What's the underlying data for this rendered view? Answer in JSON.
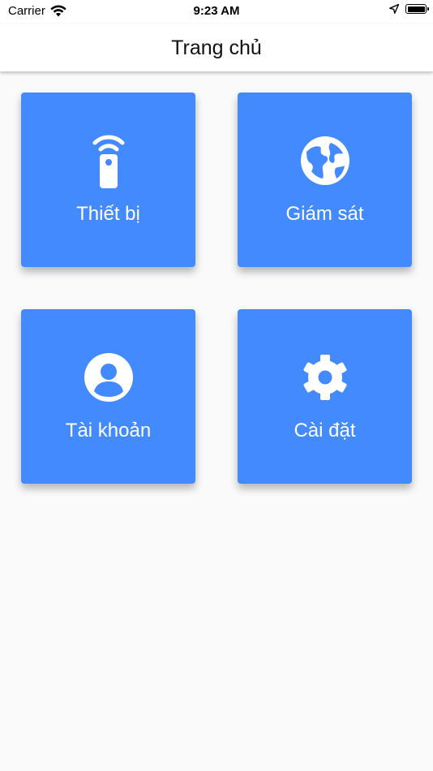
{
  "status_bar": {
    "carrier": "Carrier",
    "time": "9:23 AM",
    "icons": [
      "wifi-icon",
      "location-arrow-icon",
      "battery-icon"
    ]
  },
  "app_bar": {
    "title": "Trang chủ"
  },
  "colors": {
    "tile_background": "#448aff",
    "page_background": "#fafafa",
    "app_bar_background": "#ffffff"
  },
  "tiles": [
    {
      "label": "Thiết bị",
      "icon": "remote-control-icon"
    },
    {
      "label": "Giám sát",
      "icon": "globe-icon"
    },
    {
      "label": "Tài khoản",
      "icon": "account-circle-icon"
    },
    {
      "label": "Cài đặt",
      "icon": "gear-icon"
    }
  ]
}
